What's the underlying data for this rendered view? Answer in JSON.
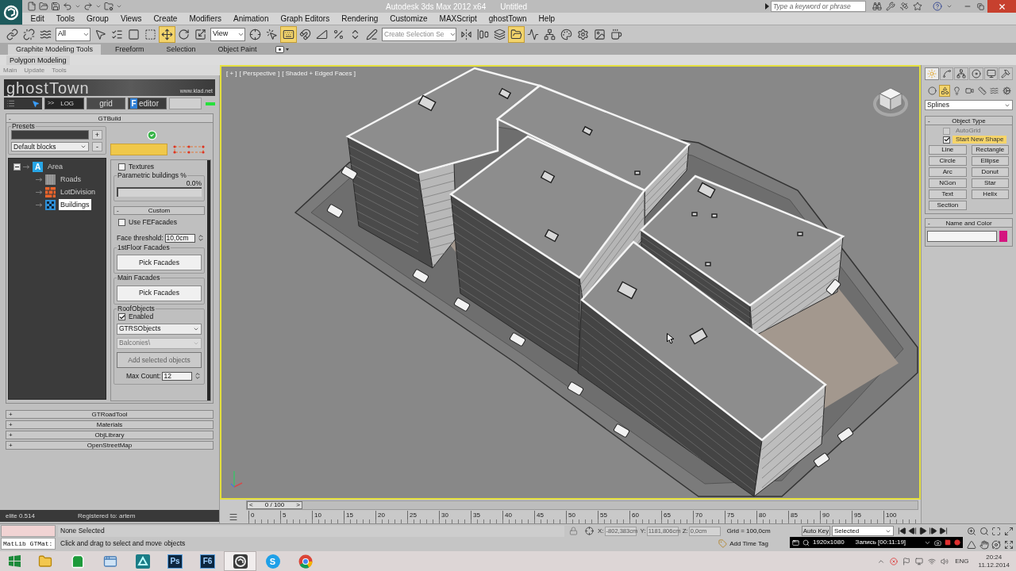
{
  "title_bar": {
    "title": "Autodesk 3ds Max 2012 x64",
    "document": "Untitled",
    "search": {
      "placeholder": "Type a keyword or phrase"
    }
  },
  "menu": [
    "Edit",
    "Tools",
    "Group",
    "Views",
    "Create",
    "Modifiers",
    "Animation",
    "Graph Editors",
    "Rendering",
    "Customize",
    "MAXScript",
    "ghostTown",
    "Help"
  ],
  "main_toolbar": [
    {
      "kind": "link",
      "selected": false
    },
    {
      "kind": "unlink",
      "selected": false
    },
    {
      "kind": "bind",
      "selected": false
    },
    {
      "kind": "dropdown",
      "value": "All"
    },
    {
      "kind": "select",
      "selected": false
    },
    {
      "kind": "select_by_name",
      "selected": false
    },
    {
      "kind": "region",
      "selected": false
    },
    {
      "kind": "crossing",
      "selected": false
    },
    {
      "kind": "move",
      "selected": true
    },
    {
      "kind": "rotate",
      "selected": false
    },
    {
      "kind": "scale",
      "selected": false
    },
    {
      "kind": "dropdown",
      "value": "View"
    },
    {
      "kind": "pivot",
      "selected": false
    },
    {
      "kind": "manipulate",
      "selected": false
    },
    {
      "kind": "shortcut",
      "selected": true
    },
    {
      "kind": "snap",
      "selected": false
    },
    {
      "kind": "angle_snap",
      "selected": false
    },
    {
      "kind": "percent_snap",
      "selected": false
    },
    {
      "kind": "spinner_snap",
      "selected": false
    },
    {
      "kind": "edit_sets",
      "selected": false
    },
    {
      "kind": "combo",
      "placeholder": "Create Selection Se"
    },
    {
      "kind": "mirror",
      "selected": false
    },
    {
      "kind": "align",
      "selected": false
    },
    {
      "kind": "layers",
      "selected": false
    },
    {
      "kind": "ribbon",
      "selected": true
    },
    {
      "kind": "curve_editor",
      "selected": false
    },
    {
      "kind": "schematic",
      "selected": false
    },
    {
      "kind": "material",
      "selected": false
    },
    {
      "kind": "render_setup",
      "selected": false
    },
    {
      "kind": "frame_window",
      "selected": false
    },
    {
      "kind": "render",
      "selected": false
    }
  ],
  "ribbon": {
    "tabs": [
      {
        "label": "Graphite Modeling Tools",
        "selected": true
      },
      {
        "label": "Freeform",
        "selected": false
      },
      {
        "label": "Selection",
        "selected": false
      },
      {
        "label": "Object Paint",
        "selected": false
      }
    ],
    "panel_tab": "Polygon Modeling",
    "panel_items": [
      "Main",
      "Update",
      "Tools"
    ]
  },
  "ghosttown": {
    "title": "ghostTown",
    "site": "www.klad.net",
    "toolbar": [
      {
        "kind": "pointer"
      },
      {
        "kind": "log",
        "prefix": ">>",
        "label": "LOG"
      },
      {
        "kind": "grid",
        "label": "grid"
      },
      {
        "kind": "editor",
        "badge": "F",
        "label": "editor"
      }
    ],
    "indicator_on": true,
    "build": {
      "toggle": "-",
      "header": "GTBuild",
      "presets": {
        "label": "Presets",
        "add": "+",
        "value": "Default blocks",
        "remove": "-"
      },
      "ready": true,
      "tree": [
        {
          "kind": "area",
          "icon_text": "A",
          "label": "Area",
          "expanded": true,
          "selected": false,
          "children": [
            {
              "kind": "roads",
              "label": "Roads",
              "selected": false
            },
            {
              "kind": "lots",
              "label": "LotDivision",
              "selected": false
            },
            {
              "kind": "buildings",
              "label": "Buildings",
              "selected": true
            }
          ]
        }
      ],
      "textures": {
        "label": "Textures",
        "checked": false
      },
      "parametric": {
        "label": "Parametric buildings %",
        "reading": "0.0%",
        "level": 0
      },
      "custom": {
        "toggle": "-",
        "header": "Custom",
        "fe_facades": {
          "label": "Use FEFacades",
          "checked": false
        },
        "face_threshold": {
          "label": "Face threshold:",
          "value": "10,0cm"
        },
        "facade_groups": [
          {
            "label": "1stFloor Facades",
            "button": "Pick Facades"
          },
          {
            "label": "Main Facades",
            "button": "Pick Facades"
          }
        ],
        "roof": {
          "label": "RoofObjects",
          "enabled": {
            "label": "Enabled",
            "checked": true
          },
          "set": {
            "value": "GTRSObjects",
            "disabled": false
          },
          "subset": {
            "value": "Balconies\\",
            "disabled": true
          },
          "add": {
            "label": "Add selected objects",
            "disabled": true
          },
          "max_count": {
            "label": "Max Count:",
            "value": "12"
          }
        }
      }
    },
    "rollouts": [
      {
        "toggle": "+",
        "label": "GTRoadTool"
      },
      {
        "toggle": "+",
        "label": "Materials"
      },
      {
        "toggle": "+",
        "label": "ObjLibrary"
      },
      {
        "toggle": "+",
        "label": "OpenStreetMap"
      }
    ],
    "footer": {
      "version": "elite 0.514",
      "registered": "Registered to: artem"
    }
  },
  "viewport": {
    "labels": [
      "[ + ]",
      "[ Perspective ]",
      "[ Shaded + Edged Faces ]"
    ]
  },
  "command_panel": {
    "tabs": [
      {
        "kind": "create",
        "selected": true
      },
      {
        "kind": "modify",
        "selected": false
      },
      {
        "kind": "hierarchy",
        "selected": false
      },
      {
        "kind": "motion",
        "selected": false
      },
      {
        "kind": "display",
        "selected": false
      },
      {
        "kind": "utilities",
        "selected": false
      }
    ],
    "categories": [
      {
        "kind": "geometry",
        "selected": false
      },
      {
        "kind": "shapes",
        "selected": true
      },
      {
        "kind": "lights",
        "selected": false
      },
      {
        "kind": "cameras",
        "selected": false
      },
      {
        "kind": "helpers",
        "selected": false
      },
      {
        "kind": "spacewarps",
        "selected": false
      },
      {
        "kind": "systems",
        "selected": false
      }
    ],
    "type": "Splines",
    "object_type": {
      "toggle": "-",
      "header": "Object Type",
      "options": [
        {
          "label": "AutoGrid",
          "checked": false,
          "disabled": true,
          "highlighted": false
        },
        {
          "label": "Start New Shape",
          "checked": true,
          "disabled": false,
          "highlighted": true
        }
      ],
      "buttons": [
        "Line",
        "Rectangle",
        "Circle",
        "Ellipse",
        "Arc",
        "Donut",
        "NGon",
        "Star",
        "Text",
        "Helix",
        "Section"
      ]
    },
    "name_color": {
      "toggle": "-",
      "header": "Name and Color",
      "color": "#d4157f"
    }
  },
  "timeline": {
    "slider": {
      "prev": "<",
      "reading": "0 / 100",
      "next": ">",
      "level": 0
    },
    "ticks": [
      "0",
      "5",
      "10",
      "15",
      "20",
      "25",
      "30",
      "35",
      "40",
      "45",
      "50",
      "55",
      "60",
      "65",
      "70",
      "75",
      "80",
      "85",
      "90",
      "95",
      "100"
    ]
  },
  "status_bar": {
    "listener": {
      "input": "MatLib GTMat:"
    },
    "selection": "None Selected",
    "prompt": "Click and drag to select and move objects",
    "coords": [
      {
        "axis": "X:",
        "value": "-802,383cm"
      },
      {
        "axis": "Y:",
        "value": "1181,806cm"
      },
      {
        "axis": "Z:",
        "value": "0,0cm"
      }
    ],
    "grid": "Grid = 100,0cm",
    "time_tag": "Add Time Tag",
    "auto_key": {
      "label": "Auto Key",
      "on": false
    },
    "key_filter": "Selected"
  },
  "recorder": {
    "resolution": "1920x1080",
    "status": "Запись [00:11:19]"
  },
  "taskbar": {
    "apps": [
      {
        "kind": "start",
        "active": false
      },
      {
        "kind": "explorer",
        "active": false
      },
      {
        "kind": "store",
        "active": false
      },
      {
        "kind": "window",
        "active": false
      },
      {
        "kind": "triangle",
        "active": false
      },
      {
        "kind": "tile",
        "label": "Ps",
        "active": false
      },
      {
        "kind": "tile",
        "label": "F6",
        "active": false
      },
      {
        "kind": "max",
        "active": true
      },
      {
        "kind": "round",
        "label": "S",
        "active": false
      },
      {
        "kind": "chrome",
        "active": false
      }
    ],
    "tray": {
      "language": "ENG",
      "time": "20:24",
      "date": "11.12.2014"
    }
  }
}
